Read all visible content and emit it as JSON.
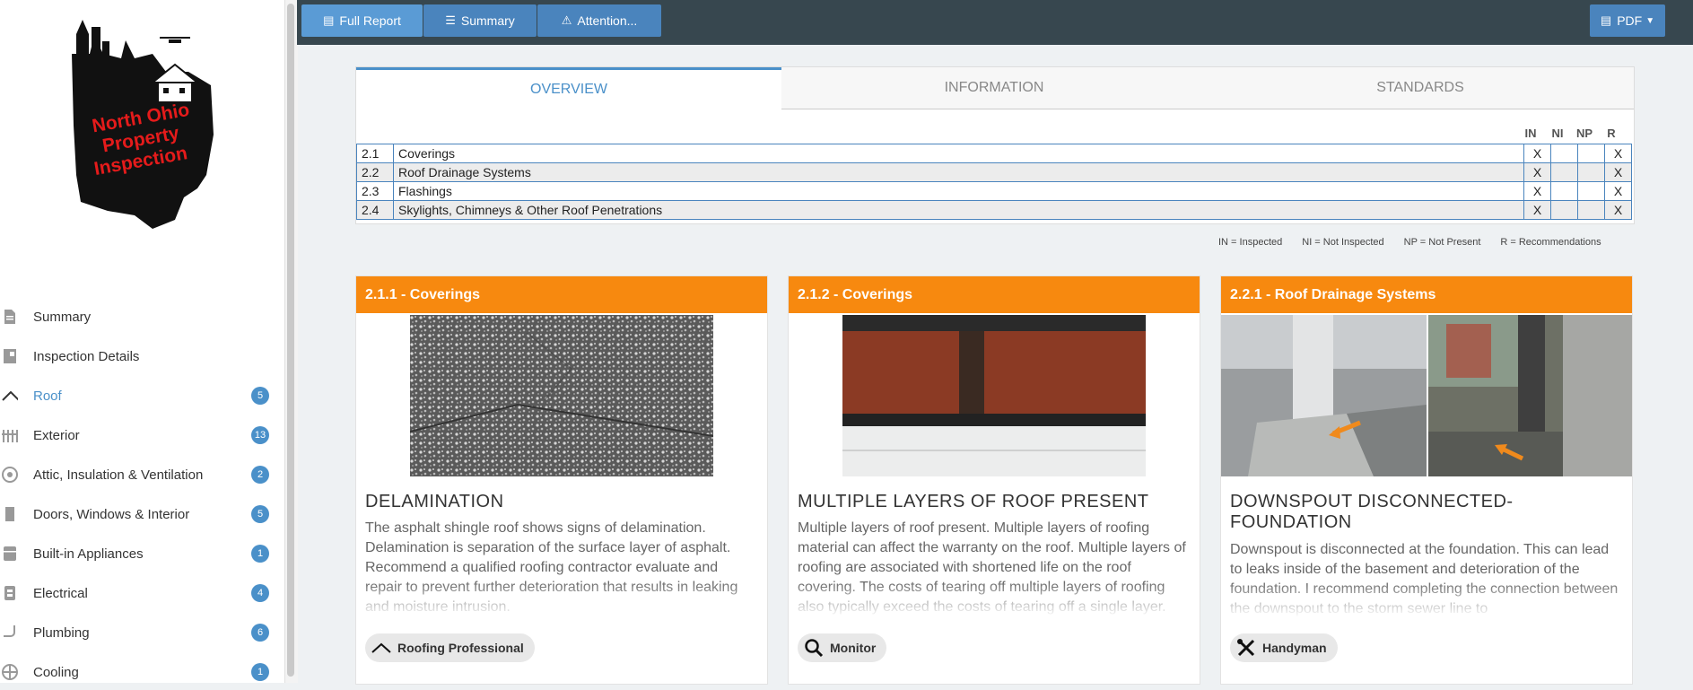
{
  "logo": {
    "lines": [
      "North Ohio",
      "Property",
      "Inspection"
    ]
  },
  "sidebar": {
    "items": [
      {
        "label": "Summary",
        "icon": "document-icon",
        "badge": ""
      },
      {
        "label": "Inspection Details",
        "icon": "details-icon",
        "badge": ""
      },
      {
        "label": "Roof",
        "icon": "roof-icon",
        "badge": "5",
        "active": true
      },
      {
        "label": "Exterior",
        "icon": "fence-icon",
        "badge": "13"
      },
      {
        "label": "Attic, Insulation & Ventilation",
        "icon": "fan-icon",
        "badge": "2"
      },
      {
        "label": "Doors, Windows & Interior",
        "icon": "door-icon",
        "badge": "5"
      },
      {
        "label": "Built-in Appliances",
        "icon": "appliance-icon",
        "badge": "1"
      },
      {
        "label": "Electrical",
        "icon": "outlet-icon",
        "badge": "4"
      },
      {
        "label": "Plumbing",
        "icon": "pipe-icon",
        "badge": "6"
      },
      {
        "label": "Cooling",
        "icon": "snowflake-icon",
        "badge": "1"
      }
    ]
  },
  "topbar": {
    "full_report": "Full Report",
    "summary": "Summary",
    "attention": "Attention...",
    "pdf": "PDF"
  },
  "overview": {
    "tabs": [
      "OVERVIEW",
      "INFORMATION",
      "STANDARDS"
    ],
    "columns": [
      "IN",
      "NI",
      "NP",
      "R"
    ],
    "rows": [
      {
        "num": "2.1",
        "name": "Coverings",
        "in": "X",
        "ni": "",
        "np": "",
        "r": "X"
      },
      {
        "num": "2.2",
        "name": "Roof Drainage Systems",
        "in": "X",
        "ni": "",
        "np": "",
        "r": "X"
      },
      {
        "num": "2.3",
        "name": "Flashings",
        "in": "X",
        "ni": "",
        "np": "",
        "r": "X"
      },
      {
        "num": "2.4",
        "name": "Skylights, Chimneys & Other Roof Penetrations",
        "in": "X",
        "ni": "",
        "np": "",
        "r": "X"
      }
    ],
    "legend": [
      "IN = Inspected",
      "NI = Not Inspected",
      "NP = Not Present",
      "R = Recommendations"
    ]
  },
  "cards": [
    {
      "header": "2.1.1 - Coverings",
      "title": "DELAMINATION",
      "text": "The asphalt shingle roof shows signs of delamination. Delamination is separation of the surface layer of asphalt. Recommend a qualified roofing contractor evaluate and repair to prevent further deterioration that results in leaking and moisture intrusion.",
      "pill": "Roofing Professional"
    },
    {
      "header": "2.1.2 - Coverings",
      "title": "MULTIPLE LAYERS OF ROOF PRESENT",
      "text": "Multiple layers of roof present.  Multiple layers of roofing material can affect the warranty on the roof.  Multiple layers of roofing are associated with shortened life on the roof covering.  The costs of tearing off multiple layers of roofing also typically exceed the costs of tearing off a single layer.",
      "pill": "Monitor"
    },
    {
      "header": "2.2.1 - Roof Drainage Systems",
      "title": "DOWNSPOUT DISCONNECTED-FOUNDATION",
      "text": "Downspout is disconnected at the foundation. This can lead to leaks inside of the basement and deterioration of the foundation. I recommend completing the connection between the downspout to the storm sewer line to",
      "pill": "Handyman"
    }
  ]
}
